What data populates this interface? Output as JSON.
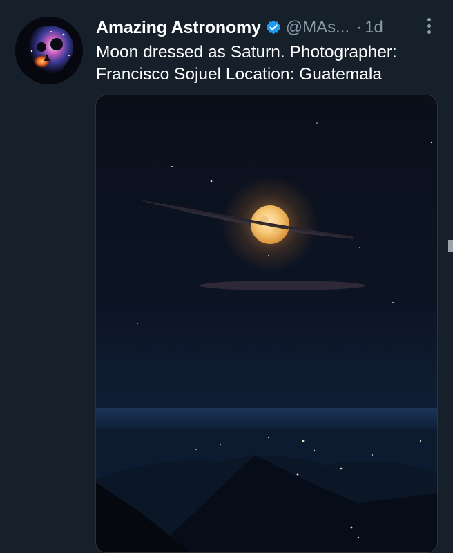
{
  "tweet": {
    "author": {
      "display_name": "Amazing Astronomy",
      "handle": "@MAs...",
      "verified": true,
      "avatar_icon": "galaxy-skull-avatar"
    },
    "separator": "·",
    "timestamp": "1d",
    "more_icon": "more-vertical-icon",
    "text": "Moon dressed as Saturn. Photographer: Francisco Sojuel Location: Guatemala",
    "media": {
      "kind": "photo",
      "subject": "full moon crossed by a thin cloud ring over volcanoes and city lights"
    }
  },
  "colors": {
    "background": "#15202b",
    "primary_text": "#ffffff",
    "secondary_text": "#8b98a5",
    "verified_badge": "#1d9bf0"
  }
}
